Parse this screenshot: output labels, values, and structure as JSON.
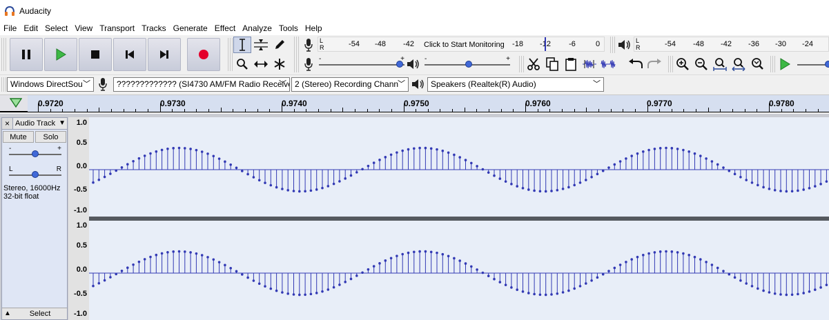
{
  "window": {
    "title": "Audacity"
  },
  "menu": [
    "File",
    "Edit",
    "Select",
    "View",
    "Transport",
    "Tracks",
    "Generate",
    "Effect",
    "Analyze",
    "Tools",
    "Help"
  ],
  "record_meter": {
    "lr": [
      "L",
      "R"
    ],
    "ticks": [
      "-54",
      "-48",
      "-42",
      "-18",
      "-12",
      "-6",
      "0"
    ],
    "prompt": "Click to Start Monitoring"
  },
  "play_meter": {
    "lr": [
      "L",
      "R"
    ],
    "ticks": [
      "-54",
      "-48",
      "-42",
      "-36",
      "-30",
      "-24"
    ]
  },
  "mixer": {
    "record_volume_symbols": [
      "-",
      "+"
    ],
    "play_volume_symbols": [
      "-",
      "+"
    ]
  },
  "devices": {
    "host": "Windows DirectSou",
    "input": "????????????? (SI4730 AM/FM Radio Receiver",
    "channels": "2 (Stereo) Recording Chann",
    "output": "Speakers (Realtek(R) Audio)"
  },
  "timeline": {
    "labels": [
      "0.9720",
      "0.9730",
      "0.9740",
      "0.9750",
      "0.9760",
      "0.9770",
      "0.9780"
    ]
  },
  "track": {
    "name": "Audio Track",
    "mute": "Mute",
    "solo": "Solo",
    "gain_symbols": [
      "-",
      "+"
    ],
    "pan_symbols": [
      "L",
      "R"
    ],
    "info_line1": "Stereo, 16000Hz",
    "info_line2": "32-bit float",
    "select": "Select",
    "close": "×",
    "menu_caret": "▼",
    "collapse_caret": "▲"
  },
  "scale": {
    "channel1": [
      "1.0",
      "0.5",
      "0.0",
      "-0.5",
      "-1.0"
    ],
    "channel2": [
      "1.0",
      "0.5",
      "0.0",
      "-0.5",
      "-1.0"
    ]
  },
  "colors": {
    "wave": "#3239b4",
    "wave_bg": "#e8eef8",
    "record": "#e4002b",
    "play": "#3db845"
  }
}
